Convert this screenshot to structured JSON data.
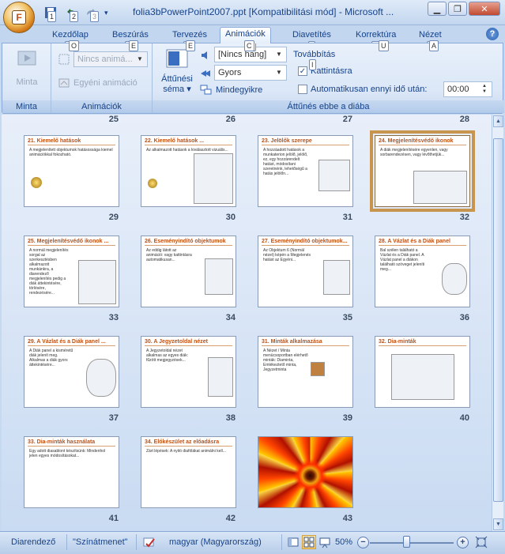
{
  "window": {
    "title": "folia3bPowerPoint2007.ppt [Kompatibilitási mód] - Microsoft ...",
    "office_button_keytip": "F",
    "qat_keytips": [
      "1",
      "2",
      "3"
    ]
  },
  "tabs": [
    {
      "label": "Kezdőlap",
      "keytip": "O"
    },
    {
      "label": "Beszúrás",
      "keytip": "E"
    },
    {
      "label": "Tervezés",
      "keytip": "E"
    },
    {
      "label": "Animációk",
      "keytip": "C",
      "active": true
    },
    {
      "label": "Diavetítés",
      "keytip": "I"
    },
    {
      "label": "Korrektúra",
      "keytip": "U"
    },
    {
      "label": "Nézet",
      "keytip": "A"
    }
  ],
  "ribbon": {
    "minta_group": {
      "button_label": "Minta",
      "group_label": "Minta"
    },
    "animaciok_group": {
      "animation_select": "Nincs animá...",
      "custom_animation": "Egyéni animáció",
      "group_label": "Animációk"
    },
    "transition_group": {
      "scheme_label_1": "Áttűnési",
      "scheme_label_2": "séma",
      "sound_select": "[Nincs hang]",
      "speed_select": "Gyors",
      "apply_all": "Mindegyikre",
      "advance_label": "Továbbítás",
      "on_click": "Kattintásra",
      "auto_after": "Automatikusan ennyi idő után:",
      "time_value": "00:00",
      "group_label": "Áttűnés ebbe a diába"
    }
  },
  "top_row_numbers": [
    "25",
    "26",
    "27",
    "28"
  ],
  "slides": [
    {
      "num": "29",
      "title": "21. Kiemelő hatások",
      "body": "A megjelenített objektumok hatásossága kiemel animációkkal fokozható."
    },
    {
      "num": "30",
      "title": "22. Kiemelő hatások ...",
      "body": "Az alkalmazott hatások a kiválasztott vizuális..."
    },
    {
      "num": "31",
      "title": "23. Jelölők szerepe",
      "body": "A hozzáadott hatások a munkaterion jelölő, jelölő, ez, egy hozzárendelt hatást, módosítani szeretnénk, lehetőségű a hatás jelölőn..."
    },
    {
      "num": "32",
      "title": "24. Megjelenítésvédő ikonok",
      "body": "A diák megjelenítésére egyenlen, vagy sorbarendezésen, vagy lévőthetjük...",
      "selected": true
    },
    {
      "num": "33",
      "title": "25. Megjelenítésvédő ikonok ...",
      "body": "A normál megjelenítés sorgal az szerkesztésben alkalmazott munkánkra, a diarendező megjelenítés pedig a diák áttekintésére, törlésére, rendezésére..."
    },
    {
      "num": "34",
      "title": "26. Eseményindító objektumok",
      "body": "Az eddig látott az animáció: vagy kattintásra automatikusan..."
    },
    {
      "num": "35",
      "title": "27. Eseményindító objektumok...",
      "body": "Az Objektum 6 (Normál nézet) képén a Megjelenés hatást az Egyéni..."
    },
    {
      "num": "36",
      "title": "28. A Vázlat és a Diák panel",
      "body": "Bal szélen található a Vázlat és a Diák panel. A Vázlat panel a diákon található szöveget jeleníti meg..."
    },
    {
      "num": "37",
      "title": "29. A Vázlat és a Diák panel ...",
      "body": "A Diák panel a kisméretű diák jelenít meg. Alkalmas a diák gyors áttekintésére..."
    },
    {
      "num": "38",
      "title": "30. A Jegyzetoldal nézet",
      "body": "A Jegyzetoldal nézet alkalmas az egyes diák: fűzött megjegyzések..."
    },
    {
      "num": "39",
      "title": "31. Minták alkalmazása",
      "body": "A Nézet / Minta menücsoportban elérhető minták: Diaminta, Emlékeztető minta, Jegyzetminta"
    },
    {
      "num": "40",
      "title": "32. Dia-minták",
      "body": ""
    },
    {
      "num": "41",
      "title": "33. Dia-minták használata",
      "body": "Egy adott diasablont készítsünk: Mindenhol jelen egyes módosításokat..."
    },
    {
      "num": "42",
      "title": "34. Előkészület az előadásra",
      "body": "Zárt lépések: A nyitó diafólákat animálni kell..."
    },
    {
      "num": "43",
      "title": "",
      "body": "",
      "image": "fractal"
    }
  ],
  "statusbar": {
    "view": "Diarendező",
    "theme": "\"Színátmenet\"",
    "language": "magyar (Magyarország)",
    "zoom": "50%"
  }
}
